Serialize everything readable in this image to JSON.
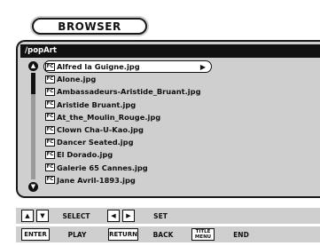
{
  "header": {
    "title": "BROWSER"
  },
  "panel": {
    "path": "/popArt",
    "files": [
      {
        "name": "Alfred la Guigne.jpg",
        "selected": true
      },
      {
        "name": "Alone.jpg"
      },
      {
        "name": "Ambassadeurs-Aristide_Bruant.jpg"
      },
      {
        "name": "Aristide Bruant.jpg"
      },
      {
        "name": "At_the_Moulin_Rouge.jpg"
      },
      {
        "name": "Clown Cha-U-Kao.jpg"
      },
      {
        "name": "Dancer Seated.jpg"
      },
      {
        "name": "El Dorado.jpg"
      },
      {
        "name": "Galerie 65 Cannes.jpg"
      },
      {
        "name": "Jane Avril-1893.jpg"
      }
    ],
    "file_icon": "FC"
  },
  "controls": {
    "row1": {
      "select_label": "SELECT",
      "set_label": "SET"
    },
    "row2": {
      "enter_key": "ENTER",
      "play_label": "PLAY",
      "return_key": "RETURN",
      "back_label": "BACK",
      "title_menu_key_line1": "TITLE",
      "title_menu_key_line2": "MENU",
      "end_label": "END"
    }
  }
}
